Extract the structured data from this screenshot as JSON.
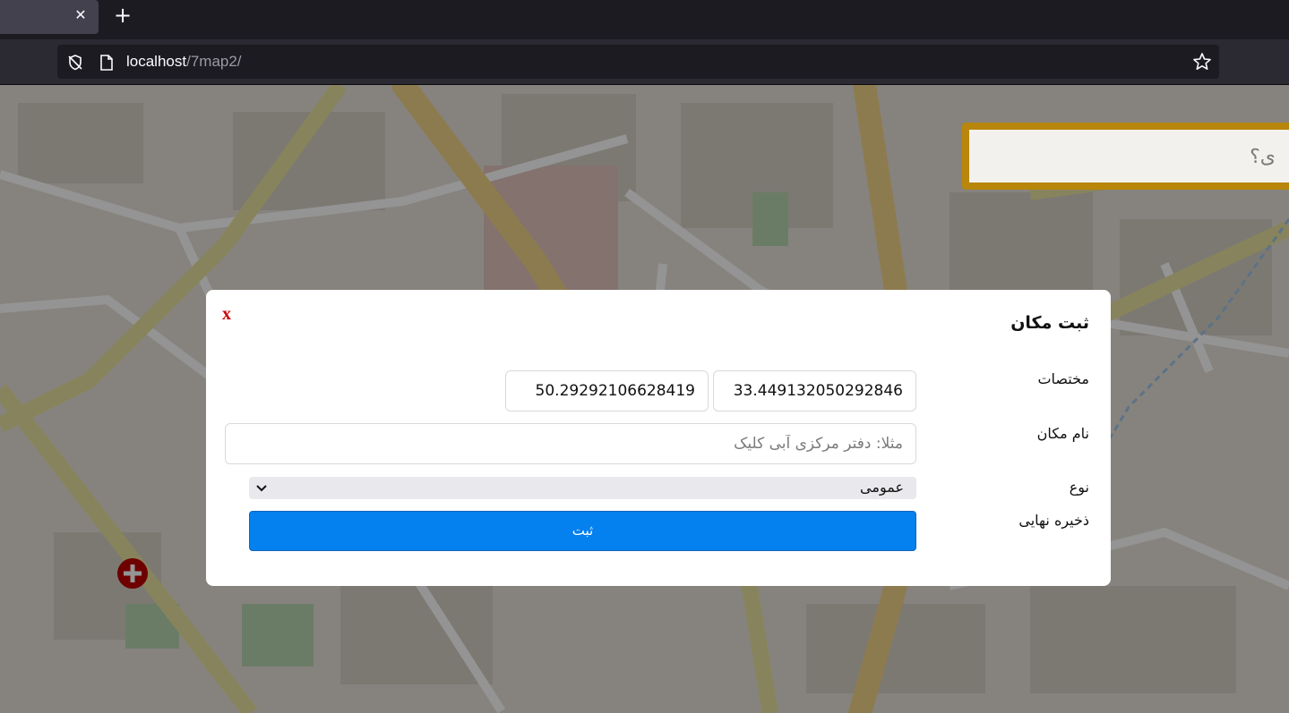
{
  "browser": {
    "url_host": "localhost",
    "url_path": "/7map2/",
    "tab_close_icon": "close-icon",
    "new_tab_icon": "plus-icon"
  },
  "map": {
    "search_text": "ی؟"
  },
  "modal": {
    "title": "ثبت مکان",
    "close_label": "x",
    "coords_label": "مختصات",
    "lat_value": "33.449132050292846",
    "lng_value": "50.29292106628419",
    "name_label": "نام مکان",
    "name_placeholder": "مثلا: دفتر مرکزی آبی کلیک",
    "type_label": "نوع",
    "type_selected": "عمومی",
    "save_label": "ذخیره نهایی",
    "submit_label": "ثبت"
  },
  "colors": {
    "submit_bg": "#0480ef",
    "close_red": "#cc0000",
    "search_border": "#b8860b"
  }
}
